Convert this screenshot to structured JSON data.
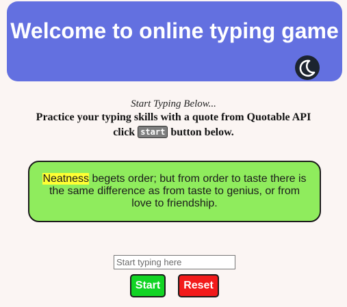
{
  "header": {
    "title": "Welcome to online typing game",
    "theme_icon": "moon-icon"
  },
  "intro": {
    "italic_line": "Start Typing Below...",
    "bold_line": "Practice your typing skills with a quote from Quotable API",
    "click_prefix": "click",
    "code_word": "start",
    "click_suffix": "button below."
  },
  "quote": {
    "highlighted_word": "Neatness",
    "rest_text": " begets order; but from order to taste there is the same difference as from taste to genius, or from love to friendship."
  },
  "input": {
    "placeholder": "Start typing here",
    "value": ""
  },
  "buttons": {
    "start_label": "Start",
    "reset_label": "Reset"
  },
  "colors": {
    "header_bg": "#6370e0",
    "quote_bg": "#8fec5d",
    "highlight": "#ffff33",
    "start_bg": "#12d424",
    "reset_bg": "#f21a1a",
    "page_bg": "#fbf5f3"
  }
}
